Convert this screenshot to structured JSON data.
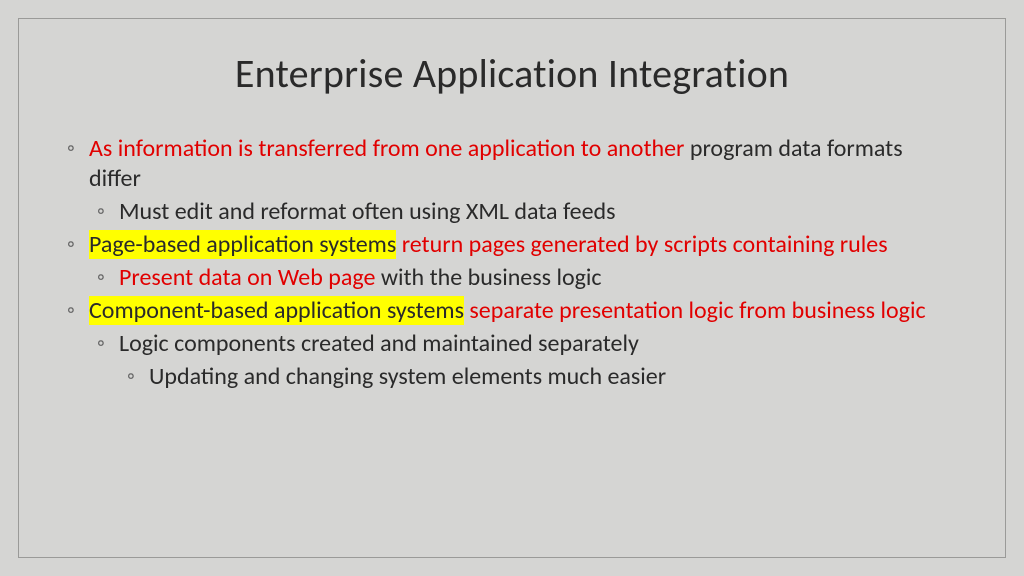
{
  "title": "Enterprise Application Integration",
  "b1_red": "As information is transferred from one application to another",
  "b1_rest": " program data formats differ",
  "b1a": "Must edit and reformat often using XML data feeds",
  "b2_hl": "Page-based application systems",
  "b2_post_hl_space": " ",
  "b2_red": "return pages generated by scripts containing rules",
  "b2a_red": "Present data on Web page",
  "b2a_rest": " with the business logic",
  "b3_hl": "Component-based application systems",
  "b3_post_hl_space": " ",
  "b3_red": "separate presentation logic from business logic",
  "b3a": "Logic components created and maintained separately",
  "b3a1": "Updating and changing system elements much easier"
}
